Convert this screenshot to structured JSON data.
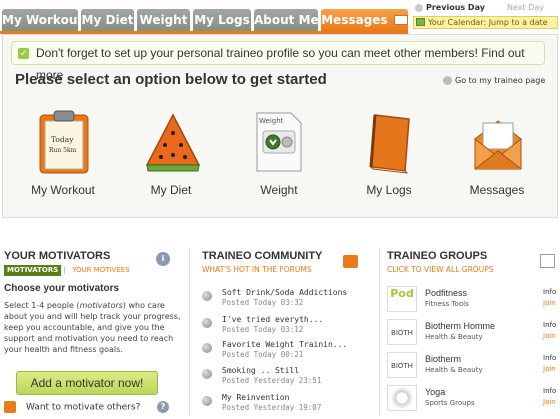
{
  "nav": {
    "tabs": [
      "My Workout",
      "My Diet",
      "Weight",
      "My Logs",
      "About Me",
      "Messages"
    ],
    "previous_day": "Previous Day",
    "next_day": "Next Day",
    "calendar_link": "Your Calendar: Jump to a date"
  },
  "notice": "Don't forget to set up your personal traineo profile so you can meet other members! Find out more",
  "heading": "Please select an option below to get started",
  "go_link": "Go to my traineo page",
  "options": [
    "My Workout",
    "My Diet",
    "Weight",
    "My Logs",
    "Messages"
  ],
  "clipboard_note": {
    "line1": "Today",
    "line2": "Run 5km"
  },
  "scale_label": "Weight",
  "motivators": {
    "title": "YOUR MOTIVATORS",
    "tab_active": "MOTIVATORS",
    "tab_inactive": "YOUR MOTIVEES",
    "choose": "Choose your motivators",
    "description_parts": [
      "Select 1-4 people (",
      "motivators",
      ") who care about you and will help track your progress, keep you accountable, and give you the support and motivation you need to reach your health and fitness goals."
    ],
    "add_button": "Add a motivator now!",
    "want": "Want to motivate others?"
  },
  "community": {
    "title": "TRAINEO COMMUNITY",
    "subtitle": "WHAT'S HOT IN THE FORUMS",
    "posts": [
      {
        "title": "Soft Drink/Soda Addictions",
        "date": "Posted Today 03:32"
      },
      {
        "title": "I've tried everyth...",
        "date": "Posted Today 03:12"
      },
      {
        "title": "Favorite Weight Trainin...",
        "date": "Posted Today 00:21"
      },
      {
        "title": "Smoking .. Still",
        "date": "Posted Yesterday 23:51"
      },
      {
        "title": "My Reinvention",
        "date": "Posted Yesterday 19:07"
      }
    ]
  },
  "groups": {
    "title": "TRAINEO GROUPS",
    "subtitle": "CLICK TO VIEW ALL GROUPS",
    "items": [
      {
        "name": "Podfitness",
        "category": "Fitness Tools",
        "logo": "Pod",
        "info": "Info",
        "join": "Join"
      },
      {
        "name": "Biotherm Homme",
        "category": "Health & Beauty",
        "logo": "BIOTH",
        "info": "Info",
        "join": "Join"
      },
      {
        "name": "Biotherm",
        "category": "Health & Beauty",
        "logo": "BIOTH",
        "info": "Info",
        "join": "Join"
      },
      {
        "name": "Yoga",
        "category": "Sports Groups",
        "logo": "",
        "info": "Info",
        "join": "Join"
      }
    ]
  },
  "colors": {
    "accent": "#e97b1a",
    "nav_tab": "#8f978f",
    "green": "#5d7d18"
  }
}
